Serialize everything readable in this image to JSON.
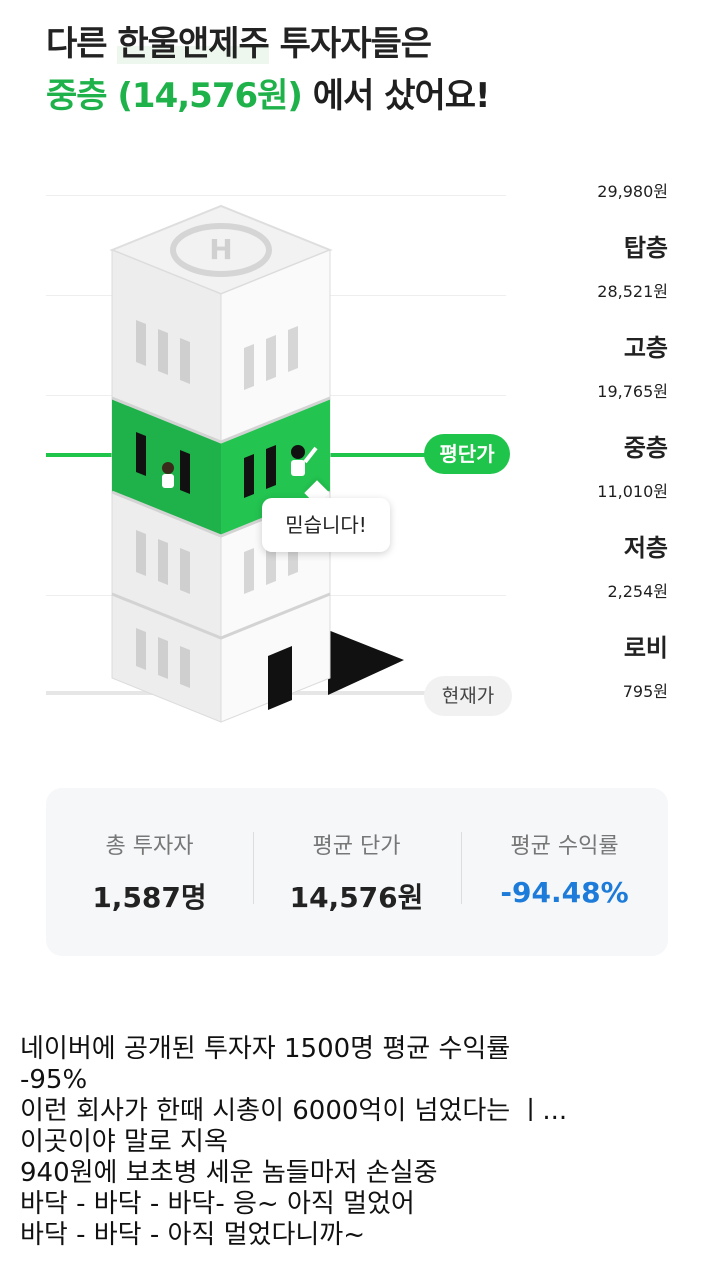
{
  "headline": {
    "line1_prefix": "다른 ",
    "line1_brand": "한울앤제주",
    "line1_suffix": " 투자자들은",
    "line2_highlight": "중층 (14,576원)",
    "line2_suffix": " 에서 샀어요!"
  },
  "floors": [
    {
      "price": "29,980원",
      "name": "탑층"
    },
    {
      "price": "28,521원",
      "name": "고층"
    },
    {
      "price": "19,765원",
      "name": "중층"
    },
    {
      "price": "11,010원",
      "name": "저층"
    },
    {
      "price": "2,254원",
      "name": "로비"
    },
    {
      "price": "795원",
      "name": ""
    }
  ],
  "markers": {
    "avg_price_label": "평단가",
    "current_price_label": "현재가",
    "speech_bubble": "믿습니다!"
  },
  "stats": [
    {
      "label": "총 투자자",
      "value": "1,587명"
    },
    {
      "label": "평균 단가",
      "value": "14,576원"
    },
    {
      "label": "평균 수익률",
      "value": "-94.48%"
    }
  ],
  "colors": {
    "green": "#1fc44a",
    "return_blue": "#1d7bd9"
  },
  "caption_lines": [
    "네이버에 공개된 투자자 1500명 평균 수익률",
    "-95%",
    "이런 회사가 한때 시총이 6000억이 넘었다는 ㅣ...",
    "이곳이야 말로 지옥",
    "940원에 보초병 세운 놈들마저 손실중",
    "바닥 - 바닥 - 바닥- 응~ 아직 멀었어",
    "바닥 - 바닥 - 아직 멀었다니까~"
  ]
}
